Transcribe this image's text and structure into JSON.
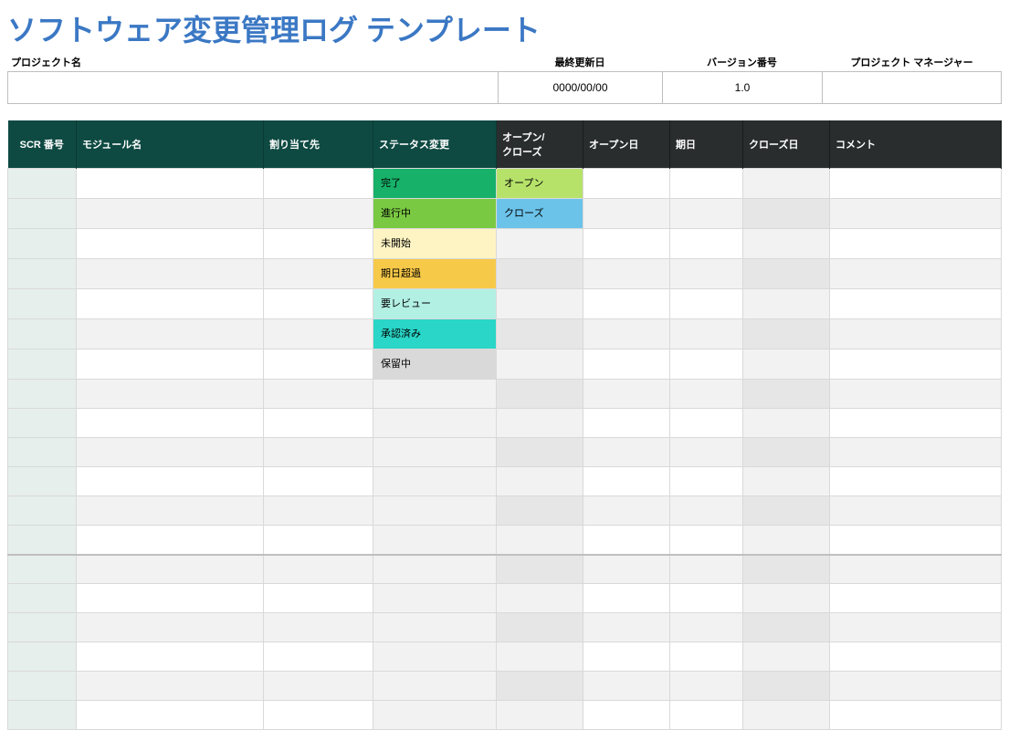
{
  "title": "ソフトウェア変更管理ログ テンプレート",
  "metaLabels": {
    "project": "プロジェクト名",
    "lastUpdated": "最終更新日",
    "version": "バージョン番号",
    "manager": "プロジェクト マネージャー"
  },
  "metaValues": {
    "project": "",
    "lastUpdated": "0000/00/00",
    "version": "1.0",
    "manager": ""
  },
  "headers": {
    "scr": "SCR 番号",
    "module": "モジュール名",
    "assign": "割り当て先",
    "status": "ステータス変更",
    "oc": "オープン/\nクローズ",
    "open": "オープン日",
    "due": "期日",
    "close": "クローズ日",
    "comment": "コメント"
  },
  "statusOptions": [
    {
      "label": "完了",
      "bg": "#17b169"
    },
    {
      "label": "進行中",
      "bg": "#7ac943"
    },
    {
      "label": "未開始",
      "bg": "#fef4c3"
    },
    {
      "label": "期日超過",
      "bg": "#f7c948"
    },
    {
      "label": "要レビュー",
      "bg": "#b2f0e3"
    },
    {
      "label": "承認済み",
      "bg": "#29d6c7"
    },
    {
      "label": "保留中",
      "bg": "#d9d9d9"
    }
  ],
  "ocOptions": [
    {
      "label": "オープン",
      "bg": "#b6e26a"
    },
    {
      "label": "クローズ",
      "bg": "#6cc3ea"
    }
  ],
  "emptyRowsAfter": 12,
  "secondBlockBreakAt": 6
}
